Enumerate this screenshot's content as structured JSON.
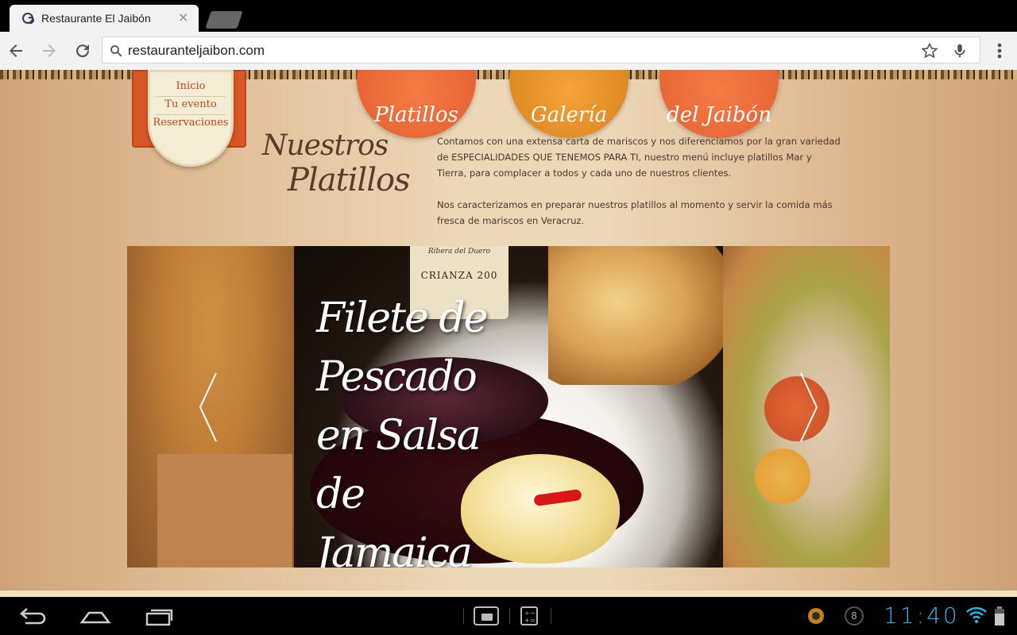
{
  "browser": {
    "tab_title": "Restaurante El Jaibón",
    "tab_close": "×",
    "url": "restauranteljaibon.com",
    "icons": [
      "back-arrow-icon",
      "forward-arrow-icon",
      "reload-icon",
      "search-icon",
      "star-icon",
      "mic-icon",
      "menu-icon"
    ]
  },
  "site": {
    "category_circles": [
      "Platillos",
      "Galería",
      "del Jaibón"
    ],
    "nav": [
      "Inicio",
      "Tu evento",
      "Reservaciones"
    ],
    "heading_line1": "Nuestros",
    "heading_line2": "Platillos",
    "intro_paragraphs": [
      "Contamos con una extensa carta de mariscos y nos diferenciamos por la gran variedad de ESPECIALIDADES QUE TENEMOS PARA TI, nuestro menú incluye platillos Mar y Tierra, para complacer a todos y cada uno de nuestros clientes.",
      "Nos caracterizamos en preparar nuestros platillos al momento y servir la comida más fresca de mariscos en Veracruz."
    ],
    "slider": {
      "current_dish": "Filete de Pescado en Salsa de Jamaica",
      "wine_label_top": "Ribera del Duero",
      "wine_label_main": "CRIANZA 200"
    }
  },
  "system_bar": {
    "clock": "11:40",
    "notification_count": "8"
  },
  "colors": {
    "accent_orange": "#e0562a",
    "clock_blue": "#33b5e5",
    "text_brown": "#5b3c2a"
  }
}
